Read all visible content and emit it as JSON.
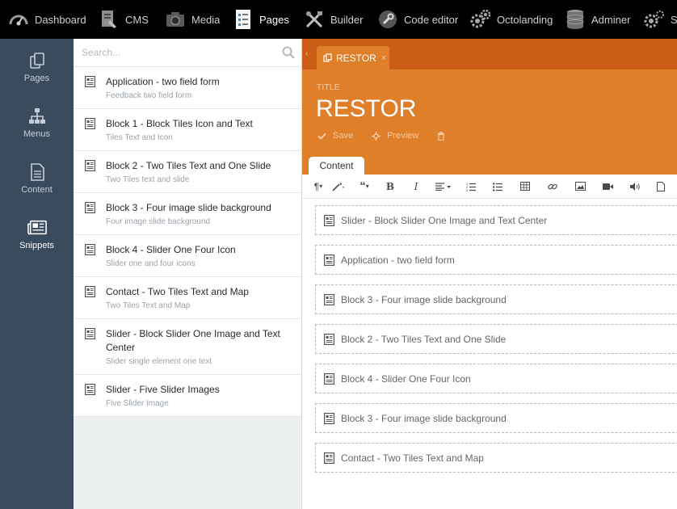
{
  "topnav": [
    {
      "label": "Dashboard",
      "icon": "dashboard-gauge-icon",
      "active": false
    },
    {
      "label": "CMS",
      "icon": "cms-document-icon",
      "active": false
    },
    {
      "label": "Media",
      "icon": "media-camera-icon",
      "active": false
    },
    {
      "label": "Pages",
      "icon": "pages-checklist-icon",
      "active": true
    },
    {
      "label": "Builder",
      "icon": "builder-tools-icon",
      "active": false
    },
    {
      "label": "Code editor",
      "icon": "code-editor-wrench-icon",
      "active": false
    },
    {
      "label": "Octolanding",
      "icon": "octolanding-gears-icon",
      "active": false
    },
    {
      "label": "Adminer",
      "icon": "adminer-database-icon",
      "active": false
    },
    {
      "label": "S",
      "icon": "settings-gear-icon",
      "active": false
    }
  ],
  "sidebar": {
    "items": [
      {
        "label": "Pages",
        "icon": "pages-icon",
        "active": false
      },
      {
        "label": "Menus",
        "icon": "menus-sitemap-icon",
        "active": false
      },
      {
        "label": "Content",
        "icon": "content-file-icon",
        "active": false
      },
      {
        "label": "Snippets",
        "icon": "snippets-newspaper-icon",
        "active": true
      }
    ]
  },
  "search": {
    "placeholder": "Search..."
  },
  "snippets": [
    {
      "title": "Application - two field form",
      "description": "Feedback two field form"
    },
    {
      "title": "Block 1 - Block Tiles Icon and Text",
      "description": "Tiles Text and Icon"
    },
    {
      "title": "Block 2 - Two Tiles Text and One Slide",
      "description": "Two Tiles text and slide"
    },
    {
      "title": "Block 3 - Four image slide background",
      "description": "Four image slide background"
    },
    {
      "title": "Block 4 - Slider One Four Icon",
      "description": "Slider one and four icons"
    },
    {
      "title": "Contact - Two Tiles Text and Map",
      "description": "Two Tiles Text and Map"
    },
    {
      "title": "Slider - Block Slider One Image and Text Center",
      "description": "Slider single element one text"
    },
    {
      "title": "Slider - Five Slider Images",
      "description": "Five Slider Image"
    }
  ],
  "editor": {
    "tab_label": "RESTOR",
    "tab_close": "×",
    "title_label": "TITLE",
    "title_value": "RESTOR",
    "actions": {
      "save": "Save",
      "preview": "Preview"
    },
    "content_tab": "Content",
    "blocks": [
      "Slider - Block Slider One Image and Text Center",
      "Application - two field form",
      "Block 3 - Four image slide background",
      "Block 2 - Two Tiles Text and One Slide",
      "Block 4 - Slider One Four Icon",
      "Block 3 - Four image slide background",
      "Contact - Two Tiles Text and Map"
    ]
  },
  "colors": {
    "topbar": "#000000",
    "sidebar": "#3a4b5e",
    "header_orange": "#e07f2a",
    "tabstrip_orange": "#cc5d16"
  }
}
